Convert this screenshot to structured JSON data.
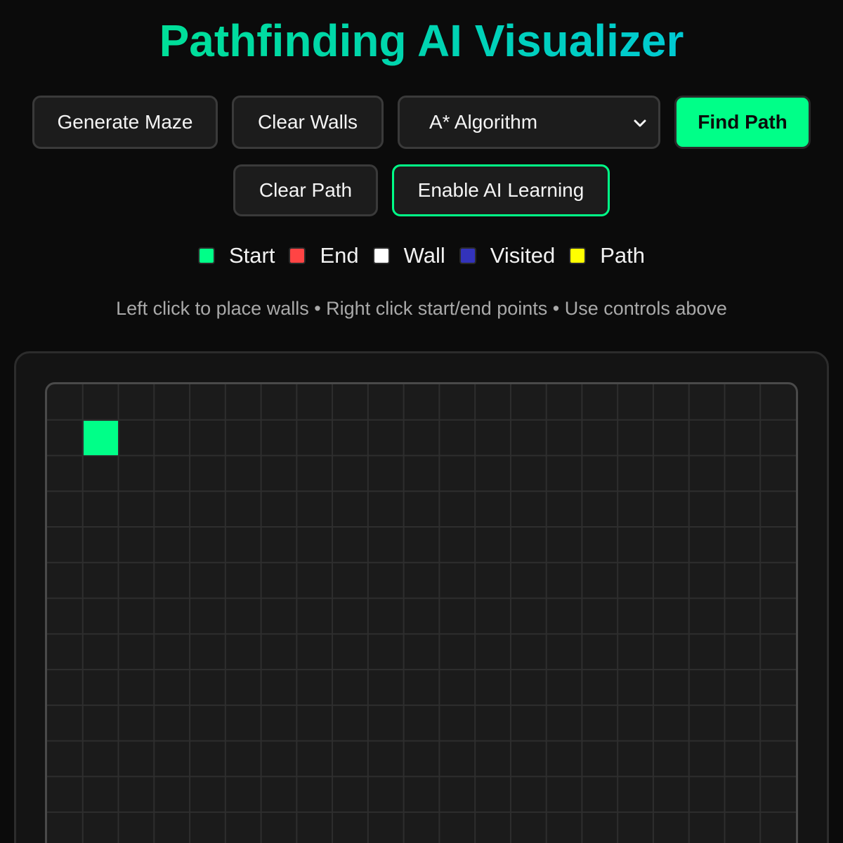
{
  "header": {
    "title": "Pathfinding AI Visualizer"
  },
  "controls": {
    "generate_maze": "Generate Maze",
    "clear_walls": "Clear Walls",
    "algorithm_selected": "A* Algorithm",
    "find_path": "Find Path",
    "clear_path": "Clear Path",
    "enable_ai": "Enable AI Learning"
  },
  "legend": [
    {
      "label": "Start",
      "color": "#00ff88"
    },
    {
      "label": "End",
      "color": "#ff4444"
    },
    {
      "label": "Wall",
      "color": "#ffffff"
    },
    {
      "label": "Visited",
      "color": "#3333bb"
    },
    {
      "label": "Path",
      "color": "#ffff00"
    }
  ],
  "instructions": "Left click to place walls • Right click start/end points • Use controls above",
  "grid": {
    "columns": 21,
    "start_cell": {
      "col": 1,
      "row": 1
    },
    "colors": {
      "background": "#1b1b1b",
      "line": "#2e2e2e",
      "start": "#00ff88"
    }
  },
  "icons": {
    "select_arrow": "chevron-down-icon"
  }
}
